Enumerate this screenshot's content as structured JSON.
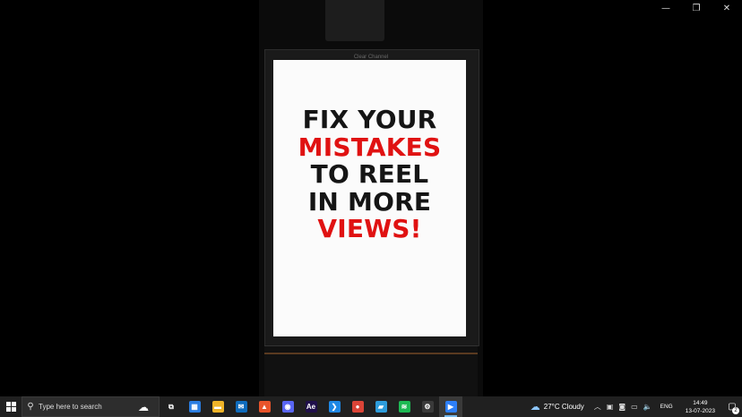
{
  "window_controls": {
    "minimize_icon": "minimize-icon",
    "restore_icon": "restore-icon",
    "close_icon": "close-icon"
  },
  "video": {
    "brand_text": "Clear Channel",
    "headline_lines": [
      {
        "text": "FIX YOUR",
        "color": "#151515"
      },
      {
        "text": "MISTAKES",
        "color": "#e01212"
      },
      {
        "text": "TO REEL",
        "color": "#151515"
      },
      {
        "text": "IN MORE",
        "color": "#151515"
      },
      {
        "text": "VIEWS!",
        "color": "#e01212"
      }
    ]
  },
  "taskbar": {
    "search_placeholder": "Type here to search",
    "apps": [
      {
        "name": "task-view-icon",
        "glyph": "⧉",
        "bg": "transparent"
      },
      {
        "name": "widgets-icon",
        "glyph": "▦",
        "bg": "#2a7de1"
      },
      {
        "name": "file-explorer-icon",
        "glyph": "▬",
        "bg": "#f0b429"
      },
      {
        "name": "mail-icon",
        "glyph": "✉",
        "bg": "#0f6cbd"
      },
      {
        "name": "brave-icon",
        "glyph": "▲",
        "bg": "#e8542b"
      },
      {
        "name": "discord-icon",
        "glyph": "◉",
        "bg": "#5865f2"
      },
      {
        "name": "after-effects-icon",
        "glyph": "Ae",
        "bg": "#1f0f4a"
      },
      {
        "name": "vscode-icon",
        "glyph": "❯",
        "bg": "#1e88e5"
      },
      {
        "name": "chrome-icon",
        "glyph": "●",
        "bg": "#db4437"
      },
      {
        "name": "app-icon",
        "glyph": "▰",
        "bg": "#2d9cdb"
      },
      {
        "name": "spotify-icon",
        "glyph": "≋",
        "bg": "#1db954"
      },
      {
        "name": "settings-icon",
        "glyph": "⚙",
        "bg": "#3a3a3a"
      },
      {
        "name": "media-player-icon",
        "glyph": "▶",
        "bg": "#2d7ff9"
      }
    ],
    "weather": {
      "temp": "27°C",
      "condition": "Cloudy"
    },
    "lang": "ENG",
    "time": "14:49",
    "date": "13-07-2023",
    "notification_count": "2"
  }
}
